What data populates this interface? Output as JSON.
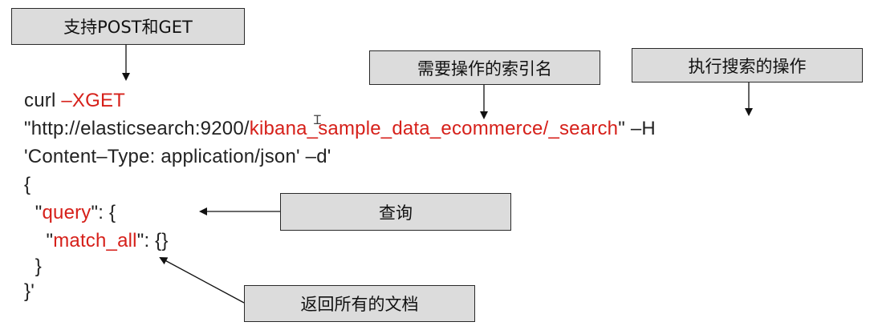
{
  "callouts": {
    "method": "支持POST和GET",
    "index_name": "需要操作的索引名",
    "operation": "执行搜索的操作",
    "query": "查询",
    "return_all": "返回所有的文档"
  },
  "code": {
    "line1": {
      "cmd": "curl ",
      "method": "–XGET"
    },
    "line2": {
      "prefix": "\"http://elasticsearch:9200/",
      "index": "kibana_sample_data_ecommerce",
      "sep": "/",
      "endpoint": "_search",
      "suffix": "\" –H"
    },
    "line3": "'Content–Type: application/json' –d'",
    "line4": "{",
    "line5": {
      "indent": "  \"",
      "key": "query",
      "rest": "\": {"
    },
    "line6": {
      "indent": "    \"",
      "key": "match_all",
      "rest": "\": {}"
    },
    "line7": "  }",
    "line8": "}'"
  },
  "colors": {
    "highlight": "#d6201a",
    "callout_fill": "#dcdcdc",
    "text": "#222222"
  }
}
